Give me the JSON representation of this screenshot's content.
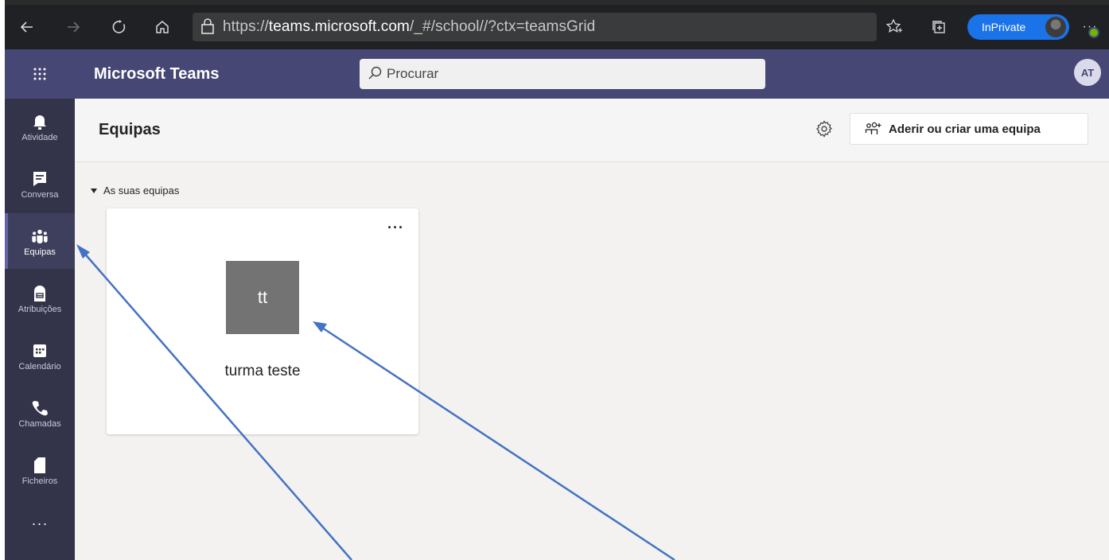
{
  "browser": {
    "url_prefix": "https://",
    "url_host": "teams.microsoft.com",
    "url_path": "/_#/school//?ctx=teamsGrid",
    "inprivate_label": "InPrivate",
    "more_label": "···",
    "icons": [
      "back-arrow-icon",
      "forward-arrow-icon",
      "refresh-icon",
      "home-icon",
      "lock-icon",
      "favorites-star-icon",
      "collections-icon",
      "profile-avatar-icon",
      "more-icon"
    ]
  },
  "header": {
    "title": "Microsoft Teams",
    "search_placeholder": "Procurar",
    "avatar_initials": "AT"
  },
  "rail": {
    "items": [
      {
        "label": "Atividade",
        "icon": "bell-icon"
      },
      {
        "label": "Conversa",
        "icon": "chat-icon"
      },
      {
        "label": "Equipas",
        "icon": "teams-icon",
        "active": true
      },
      {
        "label": "Atribuições",
        "icon": "assignments-icon"
      },
      {
        "label": "Calendário",
        "icon": "calendar-icon"
      },
      {
        "label": "Chamadas",
        "icon": "phone-icon"
      },
      {
        "label": "Ficheiros",
        "icon": "file-icon"
      }
    ],
    "more_label": "···"
  },
  "main": {
    "title": "Equipas",
    "join_button": "Aderir ou criar uma equipa",
    "section_label": "As suas equipas",
    "team_card": {
      "initials": "tt",
      "name": "turma teste",
      "more_label": "···"
    }
  },
  "colors": {
    "teams_header": "#464775",
    "rail": "#33344a",
    "accent": "#6264a7",
    "browser_bar": "#202124",
    "inprivate": "#1a73e8",
    "annotation_arrow": "#4472c4"
  }
}
